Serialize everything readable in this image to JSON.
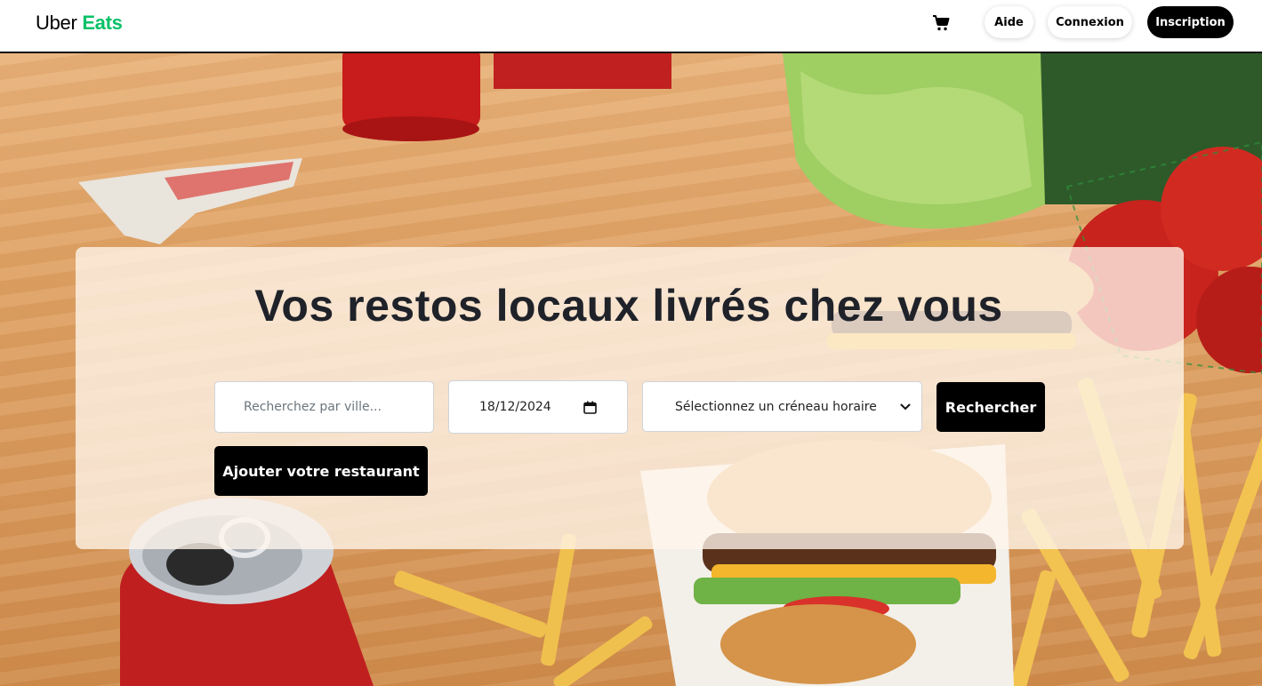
{
  "header": {
    "logo_uber": "Uber",
    "logo_eats": "Eats",
    "cart_icon": "cart-icon",
    "aide_label": "Aide",
    "connexion_label": "Connexion",
    "inscription_label": "Inscription"
  },
  "hero": {
    "headline": "Vos restos locaux livrés chez vous",
    "search": {
      "city_placeholder": "Recherchez par ville...",
      "date_value": "18/12/2024",
      "calendar_icon": "calendar-icon",
      "slot_selected": "Sélectionnez un créneau horaire",
      "chevron_icon": "chevron-down-icon",
      "search_label": "Rechercher"
    },
    "add_restaurant_label": "Ajouter votre restaurant"
  },
  "colors": {
    "brand_green": "#06c167",
    "primary_black": "#000000",
    "headline_text": "#1f2229"
  }
}
